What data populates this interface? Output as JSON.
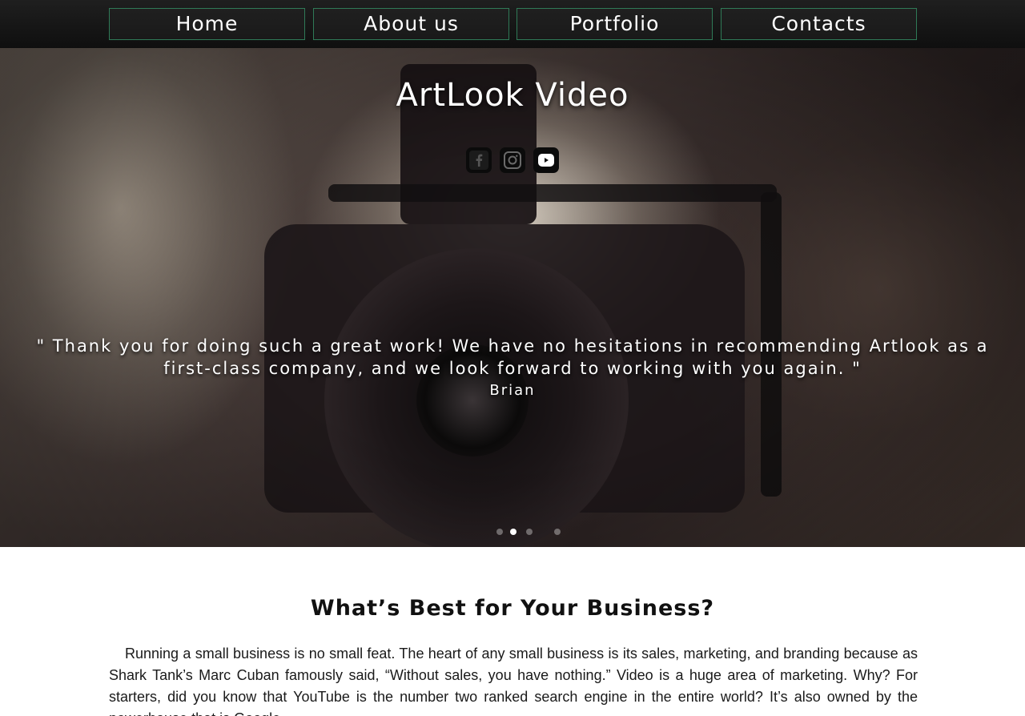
{
  "nav": {
    "items": [
      {
        "label": "Home"
      },
      {
        "label": "About us"
      },
      {
        "label": "Portfolio"
      },
      {
        "label": "Contacts"
      }
    ]
  },
  "hero": {
    "title": "ArtLook Video",
    "social": [
      {
        "icon": "facebook-icon"
      },
      {
        "icon": "instagram-icon"
      },
      {
        "icon": "youtube-icon"
      }
    ],
    "testimonial": {
      "quote": "\" Thank you for doing such a great work! We have no hesitations in recommending Artlook as a first-class company, and we look forward to working with you again. \"",
      "author": "Brian"
    },
    "slider": {
      "total": 4,
      "active_index": 1
    }
  },
  "main": {
    "heading": "What’s Best for Your Business?",
    "body": "Running a small business is no small feat. The heart of any small business is its sales, marketing, and branding because as Shark Tank’s Marc Cuban famously said, “Without sales, you have nothing.” Video is a huge area of marketing. Why? For starters, did you know that YouTube is the number two ranked search engine in the entire world? It’s also owned by the powerhouse that is Google."
  },
  "colors": {
    "nav_border": "#2f7a57",
    "nav_background": "#151515",
    "text_light": "#ffffff",
    "text_dark": "#111111"
  }
}
